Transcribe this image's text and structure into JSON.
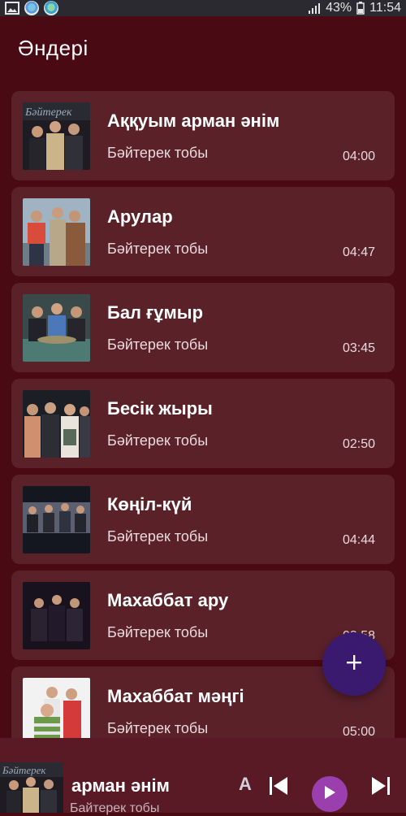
{
  "status_bar": {
    "battery": "43%",
    "time": "11:54"
  },
  "header": {
    "title": "Әндері"
  },
  "songs": [
    {
      "title": "Аққуым арман әнім",
      "artist": "Бәйтерек тобы",
      "duration": "04:00",
      "thumb_caption": "Бәйтерек"
    },
    {
      "title": "Арулар",
      "artist": "Бәйтерек тобы",
      "duration": "04:47"
    },
    {
      "title": "Бал ғұмыр",
      "artist": "Бәйтерек тобы",
      "duration": "03:45"
    },
    {
      "title": "Бесік жыры",
      "artist": "Бәйтерек тобы",
      "duration": "02:50"
    },
    {
      "title": "Көңіл-күй",
      "artist": "Бәйтерек тобы",
      "duration": "04:44"
    },
    {
      "title": "Махаббат ару",
      "artist": "Бәйтерек тобы",
      "duration": "03:58"
    },
    {
      "title": "Махаббат мәңгі",
      "artist": "Бәйтерек тобы",
      "duration": "05:00"
    }
  ],
  "fab": {
    "icon": "plus-icon",
    "symbol": "+"
  },
  "now_playing": {
    "title": "арман әнім",
    "marquee_letter": "А",
    "artist": "Байтерек тобы",
    "thumb_caption": "Бәйтерек"
  },
  "colors": {
    "background": "#4a0a13",
    "card": "#5a2129",
    "fab": "#3a1a6e",
    "play_button": "#9c3fae",
    "now_playing_bar": "#5a1a25"
  }
}
